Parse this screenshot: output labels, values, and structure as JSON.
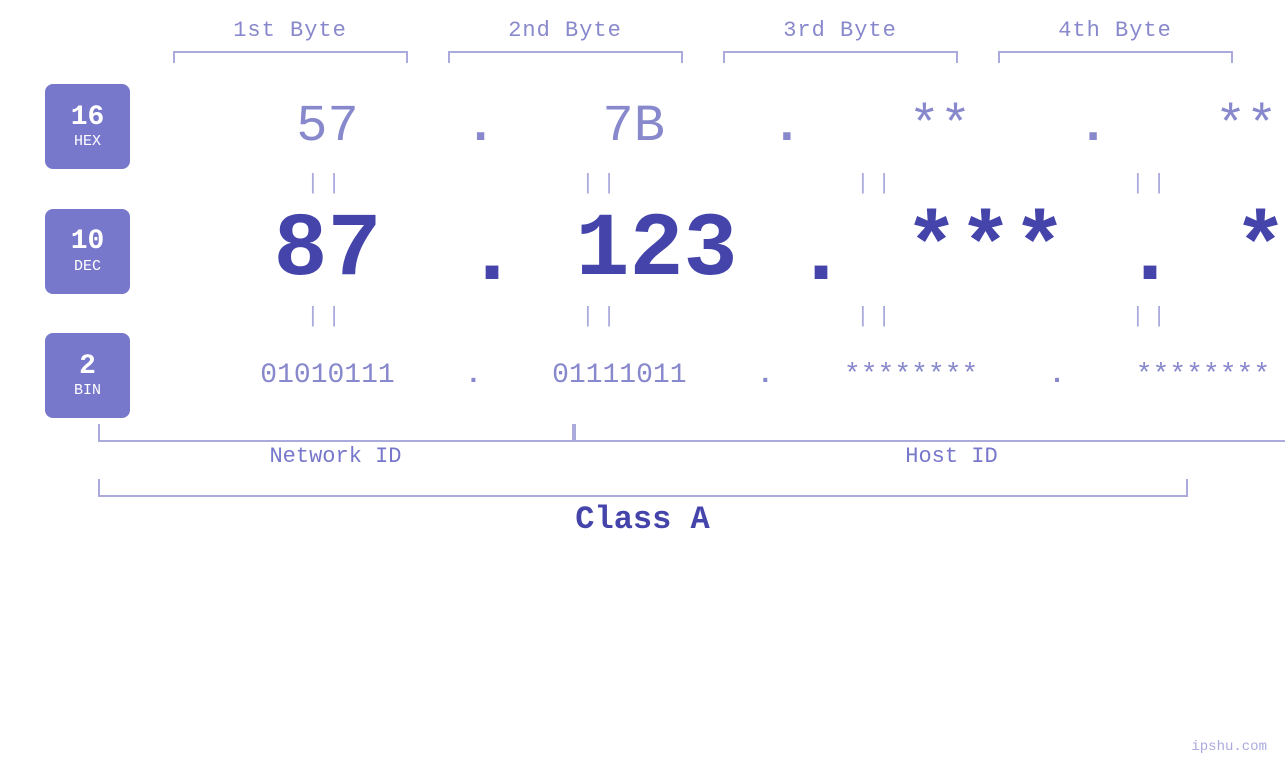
{
  "header": {
    "byte1": "1st Byte",
    "byte2": "2nd Byte",
    "byte3": "3rd Byte",
    "byte4": "4th Byte"
  },
  "badges": {
    "hex": {
      "num": "16",
      "label": "HEX"
    },
    "dec": {
      "num": "10",
      "label": "DEC"
    },
    "bin": {
      "num": "2",
      "label": "BIN"
    }
  },
  "values": {
    "hex": {
      "b1": "57",
      "b2": "7B",
      "b3": "**",
      "b4": "**"
    },
    "dec": {
      "b1": "87",
      "b2": "123",
      "b3": "***",
      "b4": "***"
    },
    "bin": {
      "b1": "01010111",
      "b2": "01111011",
      "b3": "********",
      "b4": "********"
    }
  },
  "dots": {
    "hex": ".",
    "dec": ".",
    "bin": "."
  },
  "equals": "||",
  "labels": {
    "network_id": "Network ID",
    "host_id": "Host ID",
    "class": "Class A"
  },
  "watermark": "ipshu.com"
}
